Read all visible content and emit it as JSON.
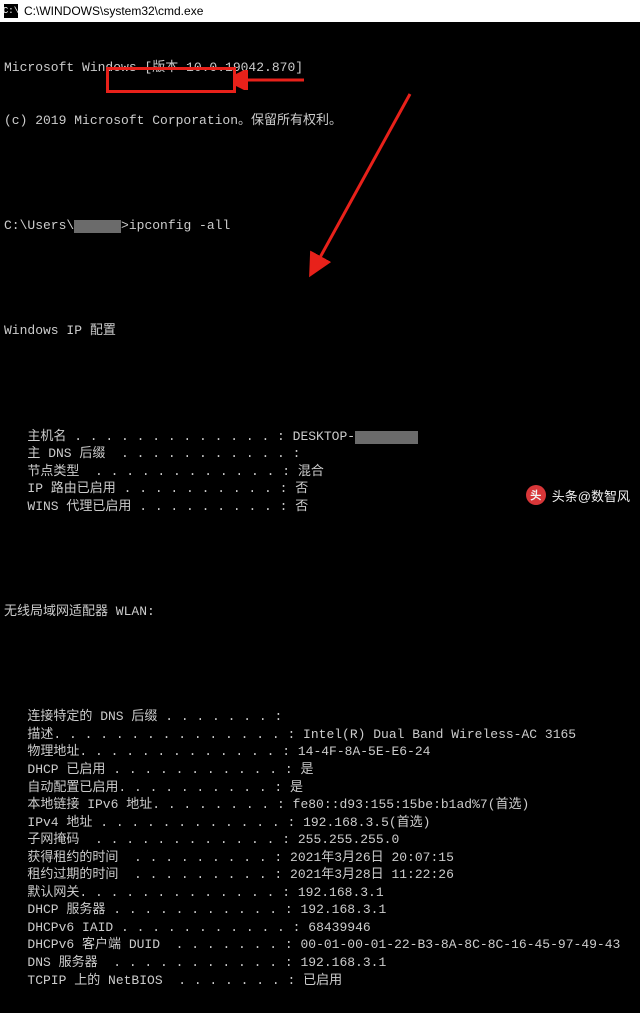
{
  "titlebar": {
    "icon_glyph": "C:\\",
    "title": "C:\\WINDOWS\\system32\\cmd.exe"
  },
  "header": {
    "line1_a": "Microsoft Windows [版本 10.0.19042.870]",
    "line2": "(c) 2019 Microsoft Corporation。保留所有权利。"
  },
  "prompt": {
    "prefix": "C:\\Users\\",
    "redacted": "      ",
    "sep": ">",
    "command": "ipconfig -all"
  },
  "section1": {
    "title": "Windows IP 配置",
    "rows": [
      {
        "label": "主机名",
        "dots": " . . . . . . . . . . . . . : ",
        "value": "DESKTOP-",
        "redacted": true
      },
      {
        "label": "主 DNS 后缀",
        "dots": "  . . . . . . . . . . . :",
        "value": ""
      },
      {
        "label": "节点类型",
        "dots": "  . . . . . . . . . . . . : ",
        "value": "混合"
      },
      {
        "label": "IP 路由已启用",
        "dots": " . . . . . . . . . . : ",
        "value": "否"
      },
      {
        "label": "WINS 代理已启用",
        "dots": " . . . . . . . . . : ",
        "value": "否"
      }
    ]
  },
  "section2": {
    "title": "无线局域网适配器 WLAN:",
    "rows": [
      {
        "label": "连接特定的 DNS 后缀",
        "dots": " . . . . . . . :",
        "value": ""
      },
      {
        "label": "描述",
        "dots": ". . . . . . . . . . . . . . . : ",
        "value": "Intel(R) Dual Band Wireless-AC 3165"
      },
      {
        "label": "物理地址",
        "dots": ". . . . . . . . . . . . . : ",
        "value": "14-4F-8A-5E-E6-24"
      },
      {
        "label": "DHCP 已启用",
        "dots": " . . . . . . . . . . . : ",
        "value": "是"
      },
      {
        "label": "自动配置已启用",
        "dots": ". . . . . . . . . . : ",
        "value": "是"
      },
      {
        "label": "本地链接 IPv6 地址",
        "dots": ". . . . . . . . : ",
        "value": "fe80::d93:155:15be:b1ad%7(首选)"
      },
      {
        "label": "IPv4 地址",
        "dots": " . . . . . . . . . . . . : ",
        "value": "192.168.3.5(首选)"
      },
      {
        "label": "子网掩码",
        "dots": "  . . . . . . . . . . . . : ",
        "value": "255.255.255.0"
      },
      {
        "label": "获得租约的时间",
        "dots": "  . . . . . . . . . : ",
        "value": "2021年3月26日 20:07:15"
      },
      {
        "label": "租约过期的时间",
        "dots": "  . . . . . . . . . : ",
        "value": "2021年3月28日 11:22:26"
      },
      {
        "label": "默认网关",
        "dots": ". . . . . . . . . . . . . : ",
        "value": "192.168.3.1"
      },
      {
        "label": "DHCP 服务器",
        "dots": " . . . . . . . . . . . : ",
        "value": "192.168.3.1"
      },
      {
        "label": "DHCPv6 IAID",
        "dots": " . . . . . . . . . . . : ",
        "value": "68439946"
      },
      {
        "label": "DHCPv6 客户端 DUID",
        "dots": "  . . . . . . . : ",
        "value": "00-01-00-01-22-B3-8A-8C-8C-16-45-97-49-43"
      },
      {
        "label": "DNS 服务器",
        "dots": "  . . . . . . . . . . . : ",
        "value": "192.168.3.1"
      },
      {
        "label": "TCPIP 上的 NetBIOS",
        "dots": "  . . . . . . . : ",
        "value": "已启用"
      }
    ]
  },
  "watermark": {
    "logo_text": "头",
    "text": "头条@数智风"
  },
  "annotation": {
    "highlight_color": "#e8211a"
  }
}
